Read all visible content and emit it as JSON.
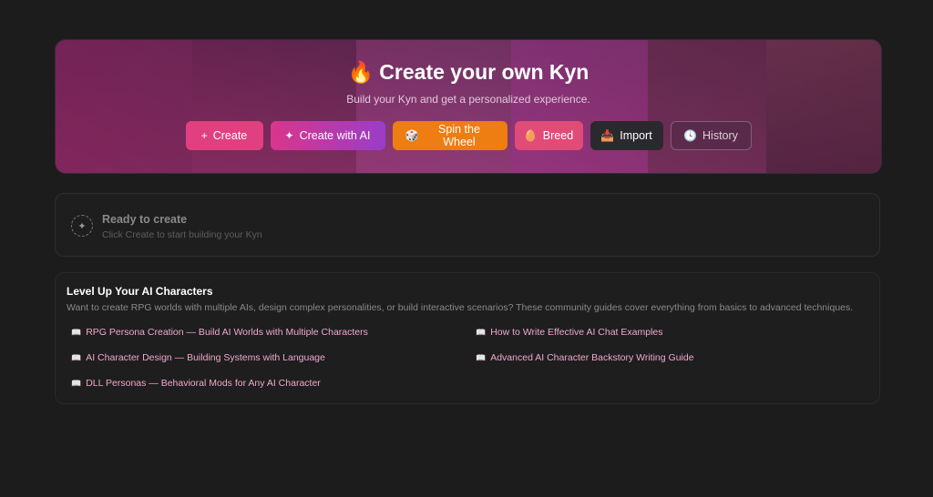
{
  "hero": {
    "title_emoji": "🔥",
    "title": "Create your own Kyn",
    "subtitle": "Build your Kyn and get a personalized experience.",
    "buttons": [
      {
        "icon": "plus-icon",
        "glyph": "+",
        "label": "Create"
      },
      {
        "icon": "sparkle-icon",
        "glyph": "✦",
        "label": "Create with AI"
      },
      {
        "icon": "dice-icon",
        "glyph": "🎲",
        "label": "Spin the Wheel"
      },
      {
        "icon": "egg-icon",
        "glyph": "🥚",
        "label": "Breed"
      },
      {
        "icon": "inbox-tray-icon",
        "glyph": "📥",
        "label": "Import"
      },
      {
        "icon": "clock-icon",
        "glyph": "🕓",
        "label": "History"
      }
    ]
  },
  "ready": {
    "icon": "sparkle-plus-icon",
    "title": "Ready to create",
    "subtitle": "Click Create to start building your Kyn"
  },
  "guides": {
    "title": "Level Up Your AI Characters",
    "description": "Want to create RPG worlds with multiple AIs, design complex personalities, or build interactive scenarios? These community guides cover everything from basics to advanced techniques.",
    "book_glyph": "📖",
    "links": [
      "RPG Persona Creation — Build AI Worlds with Multiple Characters",
      "How to Write Effective AI Chat Examples",
      "AI Character Design — Building Systems with Language",
      "Advanced AI Character Backstory Writing Guide",
      "DLL Personas — Behavioral Mods for Any AI Character"
    ]
  },
  "colors": {
    "background": "#1c1c1c",
    "accent_pink": "#e0407f",
    "accent_orange": "#ee7d12",
    "link": "#f0a8cf"
  }
}
